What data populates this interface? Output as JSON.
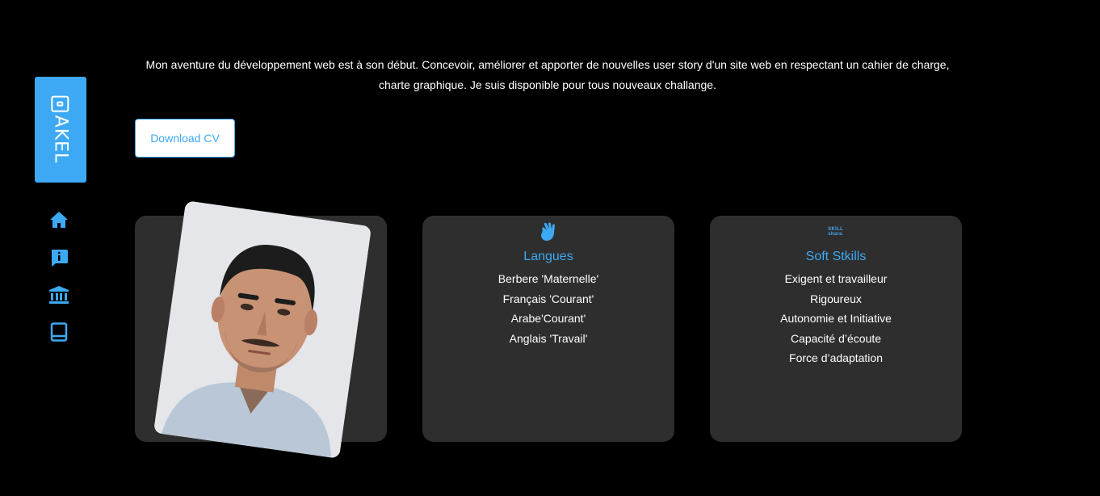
{
  "sidebar": {
    "logo_text": "AKEL",
    "logo_icon": "id-card-icon",
    "nav": [
      {
        "name": "home",
        "icon": "home-icon"
      },
      {
        "name": "about",
        "icon": "info-chat-icon"
      },
      {
        "name": "education",
        "icon": "bank-icon"
      },
      {
        "name": "portfolio",
        "icon": "book-icon"
      }
    ],
    "accent_color": "#3da9f5"
  },
  "intro": {
    "line1": "Mon aventure du développement web est à son début. Concevoir, améliorer et apporter de nouvelles user story d'un site web en respectant un cahier de charge,",
    "line2": "charte graphique. Je suis disponible pour tous nouveaux challange."
  },
  "download_cv": {
    "label": "Download CV"
  },
  "cards": {
    "photo": {
      "alt": "profile-photo"
    },
    "languages": {
      "icon": "sign-language-icon",
      "title": "Langues",
      "items": [
        "Berbere 'Maternelle'",
        "Français 'Courant'",
        "Arabe'Courant'",
        "Anglais 'Travail'"
      ]
    },
    "soft_skills": {
      "logo_line1": "SKILL",
      "logo_line2": "share.",
      "title": "Soft Stkills",
      "items": [
        "Exigent et travailleur",
        "Rigoureux",
        "Autonomie et Initiative",
        "Capacité d’écoute",
        "Force d’adaptation"
      ]
    }
  },
  "colors": {
    "background": "#000000",
    "card": "#2e2e2e",
    "accent": "#3da9f5",
    "text": "#ffffff"
  }
}
